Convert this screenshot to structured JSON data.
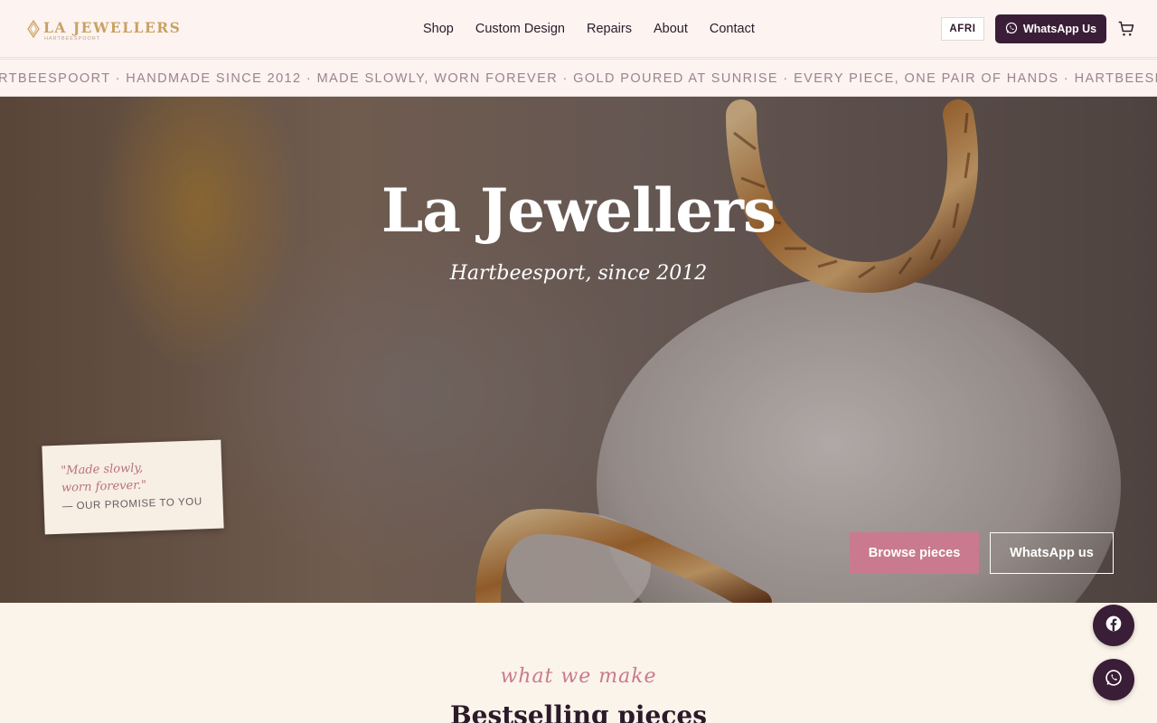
{
  "brand": {
    "name": "LA JEWELLERS",
    "tagline": "HARTBEESPOORT",
    "accent": "#c9a262"
  },
  "nav": {
    "items": [
      {
        "label": "Shop"
      },
      {
        "label": "Custom Design"
      },
      {
        "label": "Repairs"
      },
      {
        "label": "About"
      },
      {
        "label": "Contact"
      }
    ]
  },
  "header": {
    "language_label": "AFRI",
    "whatsapp_label": "WhatsApp Us",
    "cart_icon": "cart-icon"
  },
  "ticker": {
    "text": "RTBEESPOORT · HANDMADE SINCE 2012 · MADE SLOWLY, WORN FOREVER · GOLD POURED AT SUNRISE · EVERY PIECE, ONE PAIR OF HANDS · HARTBEESPOORT"
  },
  "hero": {
    "title": "La Jewellers",
    "subtitle": "Hartbeesport, since 2012",
    "note_line1": "\"Made slowly,",
    "note_line2": "worn forever.\"",
    "note_sign": "— OUR PROMISE TO YOU",
    "browse_label": "Browse pieces",
    "whatsapp_label": "WhatsApp us"
  },
  "section": {
    "eyebrow": "what we make",
    "title": "Bestselling pieces"
  },
  "floating": {
    "facebook_icon": "facebook-icon",
    "whatsapp_icon": "whatsapp-icon"
  },
  "colors": {
    "primary": "#3a1d36",
    "pink": "#c97a8e",
    "cream": "#faf4ea"
  }
}
